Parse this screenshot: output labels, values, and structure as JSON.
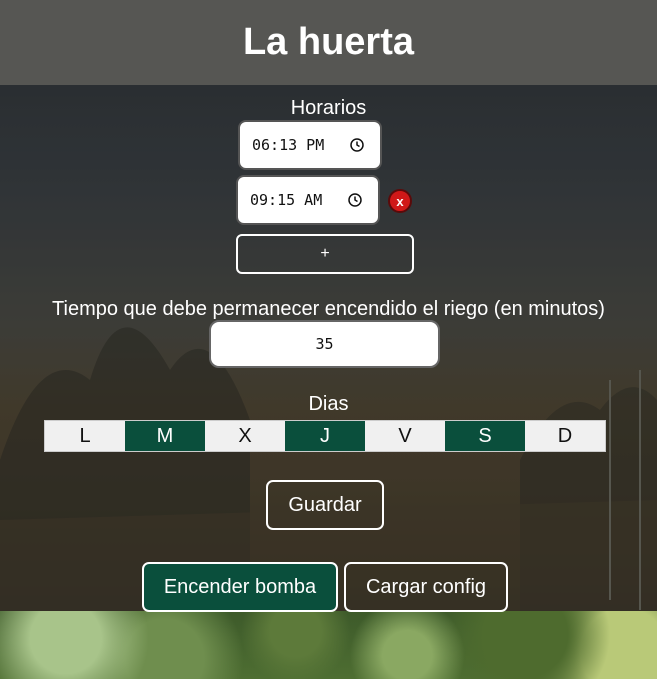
{
  "header": {
    "title": "La huerta"
  },
  "schedules": {
    "label": "Horarios",
    "times": [
      {
        "value": "06:13 PM",
        "removable": false
      },
      {
        "value": "09:15 AM",
        "removable": true
      }
    ],
    "remove_label": "x",
    "add_label": "+"
  },
  "duration": {
    "label": "Tiempo que debe permanecer encendido el riego (en minutos)",
    "value": "35"
  },
  "days": {
    "label": "Dias",
    "items": [
      {
        "label": "L",
        "active": false
      },
      {
        "label": "M",
        "active": true
      },
      {
        "label": "X",
        "active": false
      },
      {
        "label": "J",
        "active": true
      },
      {
        "label": "V",
        "active": false
      },
      {
        "label": "S",
        "active": true
      },
      {
        "label": "D",
        "active": false
      }
    ]
  },
  "actions": {
    "save_label": "Guardar",
    "pump_label": "Encender bomba",
    "load_label": "Cargar config"
  },
  "colors": {
    "accent": "#0a4f3c",
    "header_bg": "#565653",
    "delete": "#d01818"
  }
}
